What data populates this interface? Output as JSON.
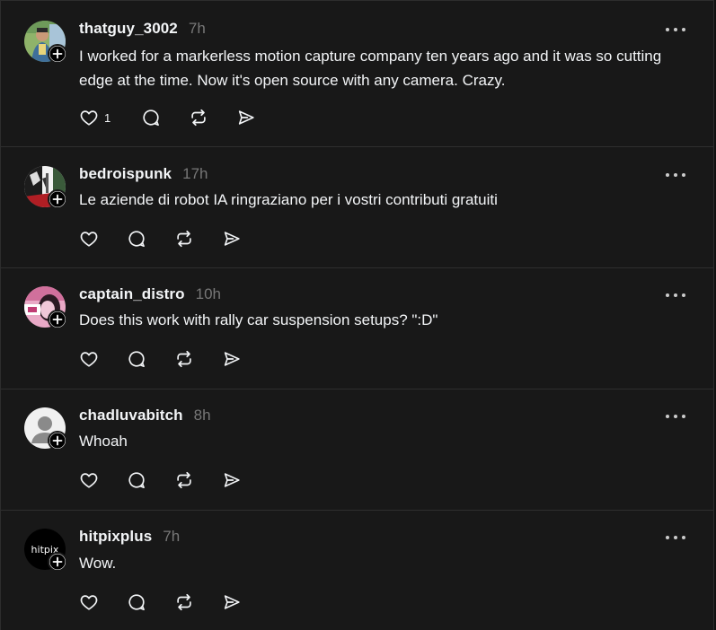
{
  "colors": {
    "background": "#181818",
    "text_primary": "#f3f5f7",
    "text_secondary": "#777777",
    "divider": "#2f2f2f"
  },
  "posts": [
    {
      "username": "thatguy_3002",
      "timestamp": "7h",
      "text": "I worked for a markerless motion capture company ten years ago and it was so cutting edge at the time. Now it's open source with any camera. Crazy.",
      "like_count": "1",
      "avatar_icon": "photo-avatar"
    },
    {
      "username": "bedroispunk",
      "timestamp": "17h",
      "text": "Le aziende di robot IA ringraziano per i vostri contributi gratuiti",
      "like_count": "",
      "avatar_icon": "photo-avatar"
    },
    {
      "username": "captain_distro",
      "timestamp": "10h",
      "text": "Does this work with rally car suspension setups? \":D\"",
      "like_count": "",
      "avatar_icon": "photo-avatar"
    },
    {
      "username": "chadluvabitch",
      "timestamp": "8h",
      "text": "Whoah",
      "like_count": "",
      "avatar_icon": "default-user-avatar"
    },
    {
      "username": "hitpixplus",
      "timestamp": "7h",
      "text": "Wow.",
      "like_count": "",
      "avatar_icon": "logo-avatar",
      "avatar_text": "hitpix"
    }
  ]
}
